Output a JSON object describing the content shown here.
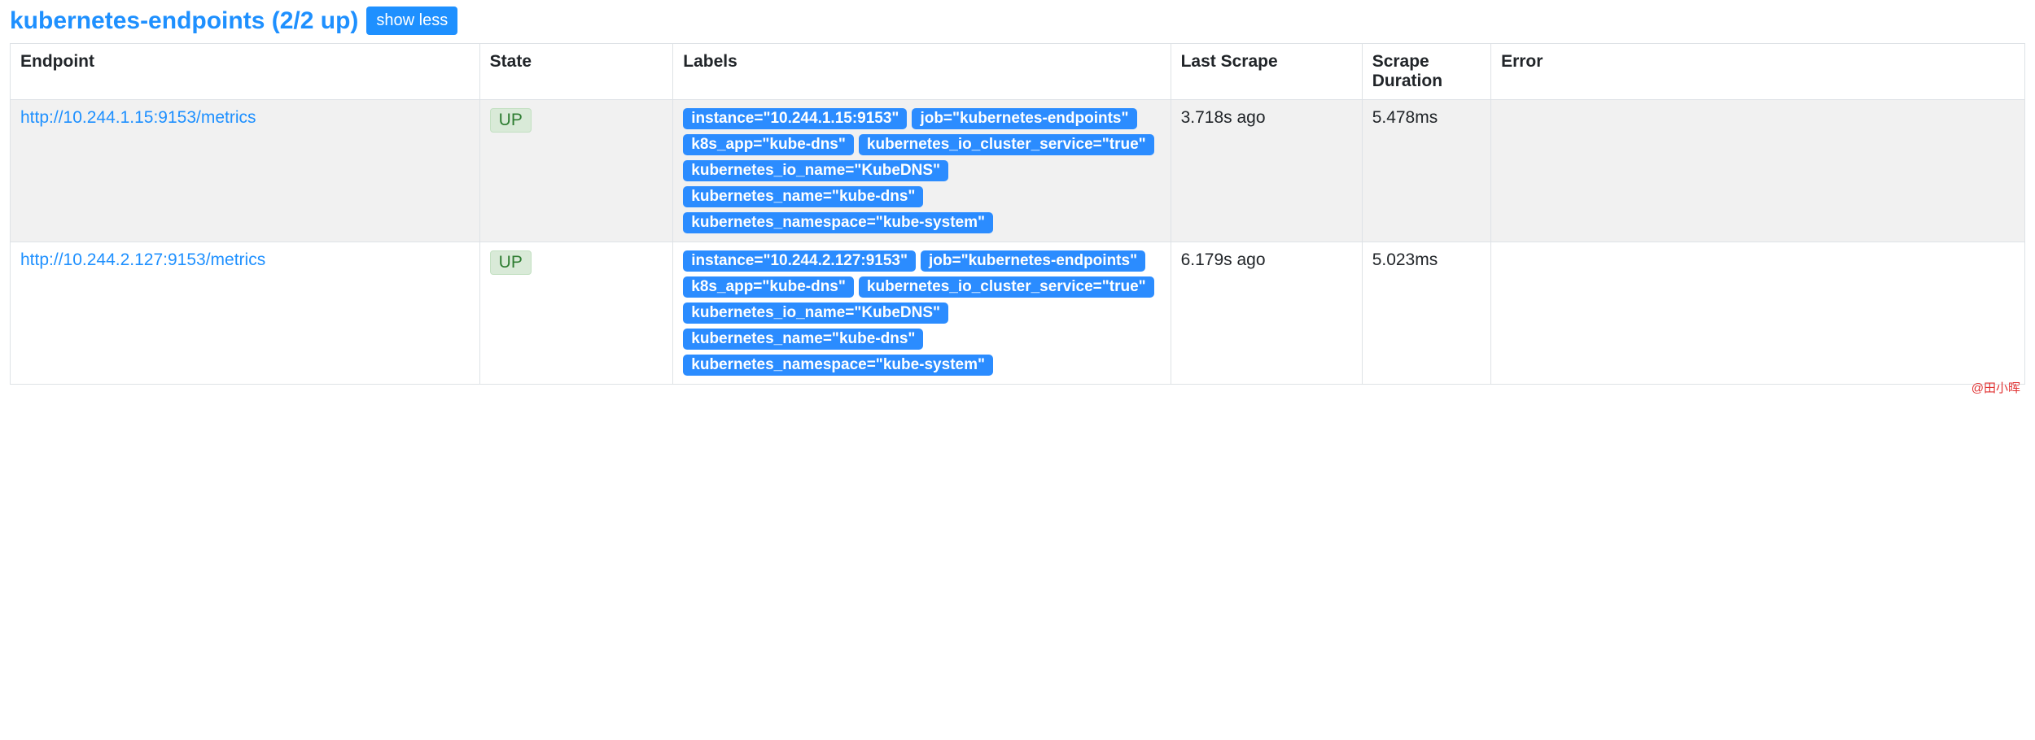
{
  "header": {
    "title": "kubernetes-endpoints (2/2 up)",
    "toggle_label": "show less"
  },
  "columns": {
    "endpoint": "Endpoint",
    "state": "State",
    "labels": "Labels",
    "last_scrape": "Last Scrape",
    "scrape_duration": "Scrape Duration",
    "error": "Error"
  },
  "targets": [
    {
      "endpoint": "http://10.244.1.15:9153/metrics",
      "state": "UP",
      "labels": [
        "instance=\"10.244.1.15:9153\"",
        "job=\"kubernetes-endpoints\"",
        "k8s_app=\"kube-dns\"",
        "kubernetes_io_cluster_service=\"true\"",
        "kubernetes_io_name=\"KubeDNS\"",
        "kubernetes_name=\"kube-dns\"",
        "kubernetes_namespace=\"kube-system\""
      ],
      "last_scrape": "3.718s ago",
      "scrape_duration": "5.478ms",
      "error": ""
    },
    {
      "endpoint": "http://10.244.2.127:9153/metrics",
      "state": "UP",
      "labels": [
        "instance=\"10.244.2.127:9153\"",
        "job=\"kubernetes-endpoints\"",
        "k8s_app=\"kube-dns\"",
        "kubernetes_io_cluster_service=\"true\"",
        "kubernetes_io_name=\"KubeDNS\"",
        "kubernetes_name=\"kube-dns\"",
        "kubernetes_namespace=\"kube-system\""
      ],
      "last_scrape": "6.179s ago",
      "scrape_duration": "5.023ms",
      "error": ""
    }
  ],
  "watermark": "@田小晖"
}
